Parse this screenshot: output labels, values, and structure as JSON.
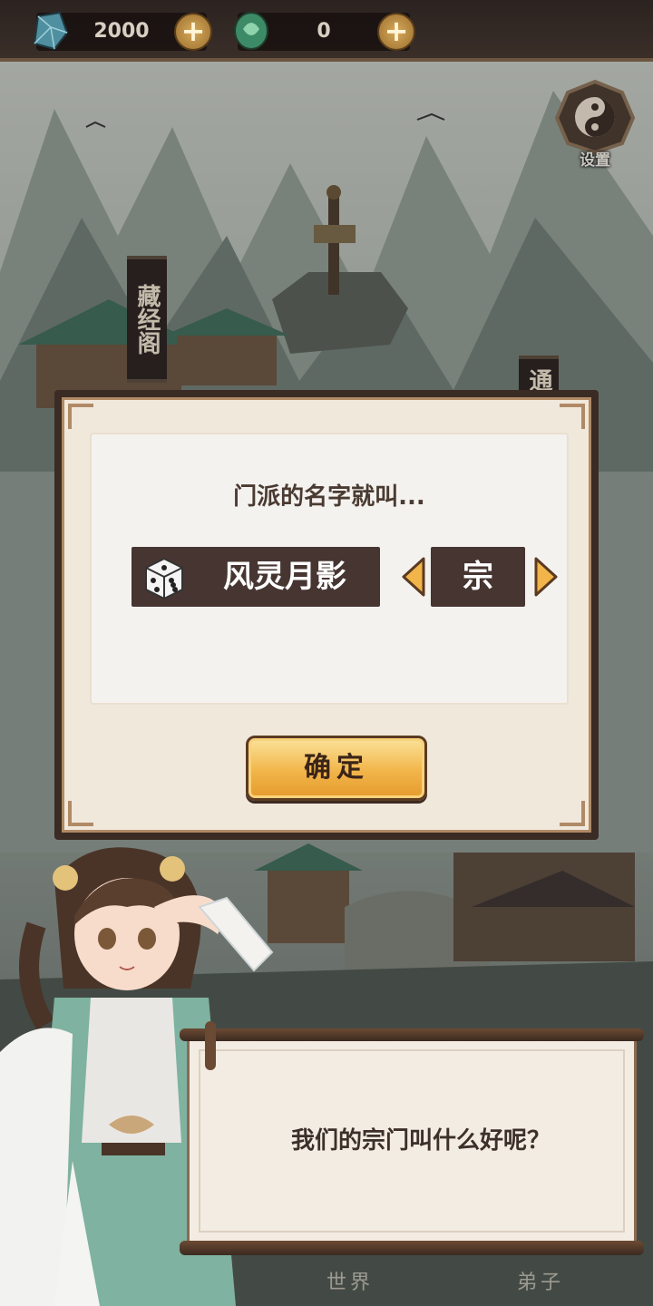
{
  "topbar": {
    "jade_amount": "2000",
    "coin_amount": "0",
    "plus_symbol": "+"
  },
  "settings": {
    "label": "设置"
  },
  "map": {
    "banner_library": "藏经阁",
    "banner_partial": "通"
  },
  "dialog": {
    "prompt": "门派的名字就叫...",
    "sect_name": "风灵月影",
    "sect_suffix": "宗",
    "confirm_label": "确定"
  },
  "speech": {
    "text": "我们的宗门叫什么好呢？"
  },
  "footer": {
    "tab_world": "世界",
    "tab_disciple": "弟子"
  },
  "colors": {
    "panel_dark": "#463531",
    "frame": "#3a2b24",
    "button_gold": "#f2b54a",
    "paper": "#f3ece3"
  },
  "icons": [
    "jade-gem-icon",
    "green-coin-icon",
    "plus-icon",
    "yin-yang-settings-icon",
    "dice-icon",
    "arrow-left-icon",
    "arrow-right-icon"
  ]
}
